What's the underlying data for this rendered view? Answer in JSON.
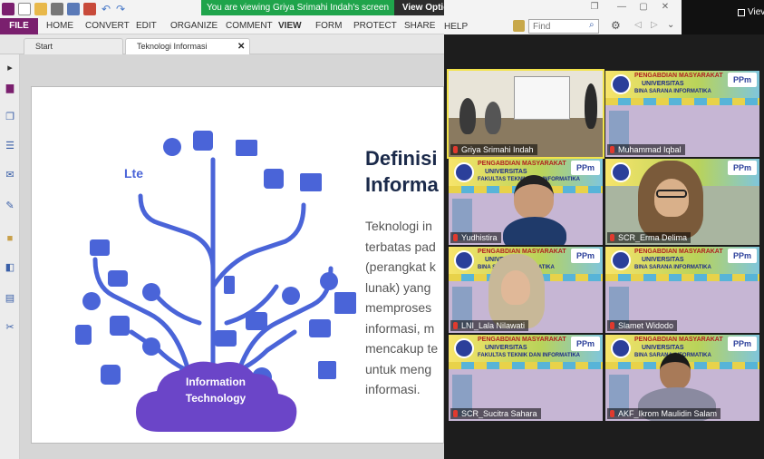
{
  "banner": {
    "text": "You are viewing Griya Srimahi Indah's screen",
    "options": "View Options ⌄"
  },
  "ribbon": {
    "tabs": [
      "FILE",
      "HOME",
      "CONVERT",
      "EDIT",
      "ORGANIZE",
      "COMMENT",
      "VIEW",
      "FORM",
      "PROTECT",
      "SHARE",
      "HELP"
    ]
  },
  "find": {
    "placeholder": "Find"
  },
  "view_top": {
    "label": "Viev"
  },
  "doc_tabs": [
    "Start",
    "Teknologi Informasi"
  ],
  "slide": {
    "title_line1": "Definisi",
    "title_line2": "Informa",
    "body": [
      "Teknologi in",
      "terbatas pad",
      "(perangkat k",
      "lunak) yang",
      "memproses",
      "informasi, m",
      "mencakup te",
      "untuk meng",
      "informasi."
    ],
    "cloud_line1": "Information",
    "cloud_line2": "Technology"
  },
  "banner_text": {
    "line1": "PENGABDIAN MASYARAKAT",
    "line2": "UNIVERSITAS",
    "line3": "BINA SARANA INFORMATIKA",
    "line4": "FAKULTAS TEKNIK DAN INFORMATIKA",
    "ppm": "PPm"
  },
  "participants": [
    "Griya Srimahi Indah",
    "Muhammad Iqbal",
    "Yudhistira",
    "SCR_Erma Delima",
    "LNI_Lala Nilawati",
    "Slamet Widodo",
    "SCR_Sucitra Sahara",
    "AKF_Ikrom Maulidin Salam"
  ],
  "colors": {
    "ribbon_file": "#7a1f6e",
    "banner": "#1fa44b",
    "tree_blue": "#4a64d8",
    "cloud_purple": "#6b45c8",
    "active_speaker": "#f2e34a"
  }
}
